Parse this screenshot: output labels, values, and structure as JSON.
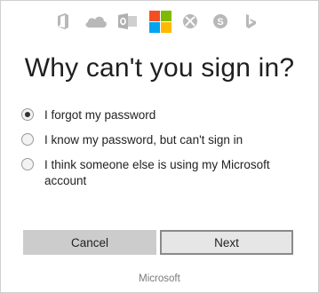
{
  "header": {
    "icons": [
      "office-icon",
      "onedrive-icon",
      "outlook-icon",
      "microsoft-logo",
      "xbox-icon",
      "skype-icon",
      "bing-icon"
    ]
  },
  "title": "Why can't you sign in?",
  "options": [
    {
      "label": "I forgot my password",
      "checked": true
    },
    {
      "label": "I know my password, but can't sign in",
      "checked": false
    },
    {
      "label": "I think someone else is using my Microsoft account",
      "checked": false
    }
  ],
  "buttons": {
    "cancel": "Cancel",
    "next": "Next"
  },
  "footer": "Microsoft",
  "colors": {
    "ms_red": "#f25022",
    "ms_green": "#7fba00",
    "ms_blue": "#00a4ef",
    "ms_yellow": "#ffb900",
    "icon_gray": "#b3b3b3"
  }
}
